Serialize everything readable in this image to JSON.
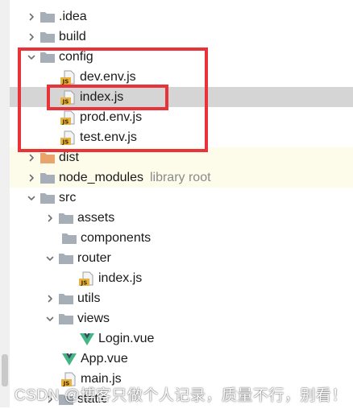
{
  "colors": {
    "folder": "#a6afb8",
    "folder_orange": "#e9a46c",
    "js_badge": "#e8b23e",
    "vue_green": "#41b883",
    "vue_dark": "#35495e",
    "highlight": "#e8333a",
    "selected_bg": "#d5d5d5",
    "excluded_bg": "#fdfcea"
  },
  "tree": {
    "rows": [
      {
        "label": ".idea",
        "type": "folder",
        "arrow": "right",
        "hint": ""
      },
      {
        "label": "build",
        "type": "folder",
        "arrow": "right",
        "hint": ""
      },
      {
        "label": "config",
        "type": "folder",
        "arrow": "down",
        "hint": ""
      },
      {
        "label": "dev.env.js",
        "type": "js",
        "arrow": "",
        "hint": ""
      },
      {
        "label": "index.js",
        "type": "js",
        "arrow": "",
        "hint": "",
        "selected": true
      },
      {
        "label": "prod.env.js",
        "type": "js",
        "arrow": "",
        "hint": ""
      },
      {
        "label": "test.env.js",
        "type": "js",
        "arrow": "",
        "hint": ""
      },
      {
        "label": "dist",
        "type": "folder-orange",
        "arrow": "right",
        "hint": "",
        "excluded": true
      },
      {
        "label": "node_modules",
        "type": "folder",
        "arrow": "right",
        "hint": "library root",
        "excluded": true
      },
      {
        "label": "src",
        "type": "folder",
        "arrow": "down",
        "hint": ""
      },
      {
        "label": "assets",
        "type": "folder",
        "arrow": "right",
        "hint": ""
      },
      {
        "label": "components",
        "type": "folder",
        "arrow": "",
        "hint": ""
      },
      {
        "label": "router",
        "type": "folder",
        "arrow": "down",
        "hint": ""
      },
      {
        "label": "index.js",
        "type": "js",
        "arrow": "",
        "hint": ""
      },
      {
        "label": "utils",
        "type": "folder",
        "arrow": "right",
        "hint": ""
      },
      {
        "label": "views",
        "type": "folder",
        "arrow": "down",
        "hint": ""
      },
      {
        "label": "Login.vue",
        "type": "vue",
        "arrow": "",
        "hint": ""
      },
      {
        "label": "App.vue",
        "type": "vue",
        "arrow": "",
        "hint": ""
      },
      {
        "label": "main.js",
        "type": "js",
        "arrow": "",
        "hint": ""
      },
      {
        "label": "static",
        "type": "folder",
        "arrow": "right",
        "hint": ""
      }
    ]
  },
  "watermark": {
    "text": "CSDN @博客只做个人记录，质量不行，别看！"
  }
}
